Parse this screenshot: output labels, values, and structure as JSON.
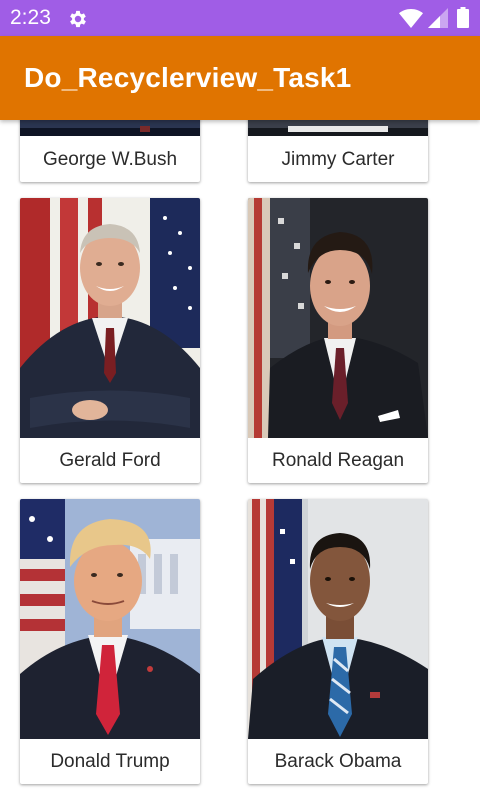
{
  "status_bar": {
    "time": "2:23",
    "icons": [
      "gear-icon",
      "wifi-icon",
      "signal-icon",
      "battery-icon"
    ],
    "background": "#a05de6"
  },
  "app_bar": {
    "title": "Do_Recyclerview_Task1",
    "background": "#e07400"
  },
  "presidents": [
    {
      "name": "George W.Bush"
    },
    {
      "name": "Jimmy Carter"
    },
    {
      "name": "Gerald Ford"
    },
    {
      "name": "Ronald Reagan"
    },
    {
      "name": "Donald Trump"
    },
    {
      "name": "Barack Obama"
    }
  ]
}
